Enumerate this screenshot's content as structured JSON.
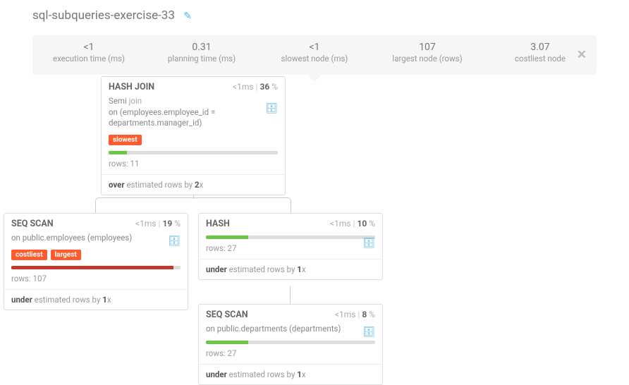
{
  "title": "sql-subqueries-exercise-33",
  "stats": [
    {
      "val": "<1",
      "lbl": "execution time (ms)"
    },
    {
      "val": "0.31",
      "lbl": "planning time (ms)"
    },
    {
      "val": "<1",
      "lbl": "slowest node (ms)"
    },
    {
      "val": "107",
      "lbl": "largest node (rows)"
    },
    {
      "val": "3.07",
      "lbl": "costliest node"
    }
  ],
  "nodes": {
    "hashjoin": {
      "name": "HASH JOIN",
      "time": "<1ms",
      "pct": "36",
      "desc_prefix": "Semi ",
      "desc_kw": "join",
      "desc_rest": "on (employees.employee_id = departments.manager_id)",
      "badge_slow": "slowest",
      "rows": "rows: 11",
      "est": [
        "over",
        " estimated rows by ",
        "2",
        "x"
      ]
    },
    "seq1": {
      "name": "SEQ SCAN",
      "time": "<1ms",
      "pct": "19",
      "desc": "on public.employees (employees)",
      "badge_cost": "costliest",
      "badge_larg": "largest",
      "rows": "rows: 107",
      "est": [
        "under",
        " estimated rows by ",
        "1",
        "x"
      ]
    },
    "hash": {
      "name": "HASH",
      "time": "<1ms",
      "pct": "10",
      "rows": "rows: 27",
      "est": [
        "under",
        " estimated rows by ",
        "1",
        "x"
      ]
    },
    "seq2": {
      "name": "SEQ SCAN",
      "time": "<1ms",
      "pct": "8",
      "desc": "on public.departments (departments)",
      "rows": "rows: 27",
      "est": [
        "under",
        " estimated rows by ",
        "1",
        "x"
      ]
    }
  }
}
